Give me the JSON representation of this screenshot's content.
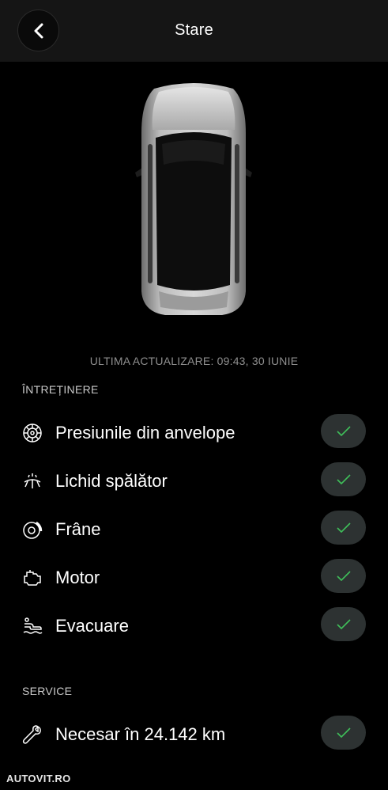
{
  "header": {
    "title": "Stare",
    "back_icon": "chevron-left-icon"
  },
  "status": {
    "last_update": "ULTIMA ACTUALIZARE: 09:43, 30 IUNIE"
  },
  "maintenance": {
    "section_label": "ÎNTREȚINERE",
    "items": [
      {
        "label": "Presiunile din anvelope",
        "icon": "tire-icon",
        "status": "ok"
      },
      {
        "label": "Lichid spălător",
        "icon": "washer-fluid-icon",
        "status": "ok"
      },
      {
        "label": "Frâne",
        "icon": "brake-icon",
        "status": "ok"
      },
      {
        "label": "Motor",
        "icon": "engine-icon",
        "status": "ok"
      },
      {
        "label": "Evacuare",
        "icon": "exhaust-icon",
        "status": "ok"
      }
    ]
  },
  "service": {
    "section_label": "SERVICE",
    "items": [
      {
        "label": "Necesar în 24.142 km",
        "icon": "wrench-icon",
        "status": "ok"
      }
    ]
  },
  "watermark": {
    "text": "AUTOVIT.RO"
  },
  "colors": {
    "background": "#000000",
    "header": "#151515",
    "check_pill": "#2d3232",
    "check_mark": "#3fbf5a",
    "muted_text": "#8f8f8f"
  }
}
